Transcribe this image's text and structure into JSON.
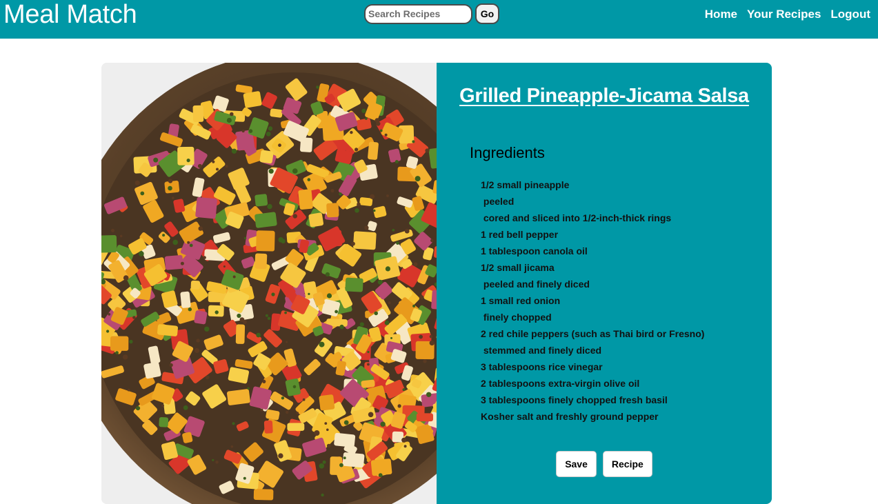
{
  "navbar": {
    "brand": "Meal Match",
    "search": {
      "placeholder": "Search Recipes",
      "value": "",
      "go_label": "Go"
    },
    "links": [
      "Home",
      "Your Recipes",
      "Logout"
    ]
  },
  "recipe": {
    "title": "Grilled Pineapple-Jicama Salsa",
    "image_icon": "salsa-photo",
    "ingredients_heading": "Ingredients",
    "ingredients": [
      "1/2 small pineapple",
      " peeled",
      " cored and sliced into 1/2-inch-thick rings",
      "1 red bell pepper",
      "1 tablespoon canola oil",
      "1/2 small jicama",
      " peeled and finely diced",
      "1 small red onion",
      " finely chopped",
      "2 red chile peppers (such as Thai bird or Fresno)",
      " stemmed and finely diced",
      "3 tablespoons rice vinegar",
      "2 tablespoons extra-virgin olive oil",
      "3 tablespoons finely chopped fresh basil",
      "Kosher salt and freshly ground pepper"
    ],
    "actions": {
      "save_label": "Save",
      "recipe_label": "Recipe"
    }
  },
  "colors": {
    "accent": "#0098a6",
    "text_on_accent": "#ffffff",
    "bowl": "#6b4a2e",
    "pineapple": "#f2b52c",
    "pepper": "#d63a24"
  }
}
